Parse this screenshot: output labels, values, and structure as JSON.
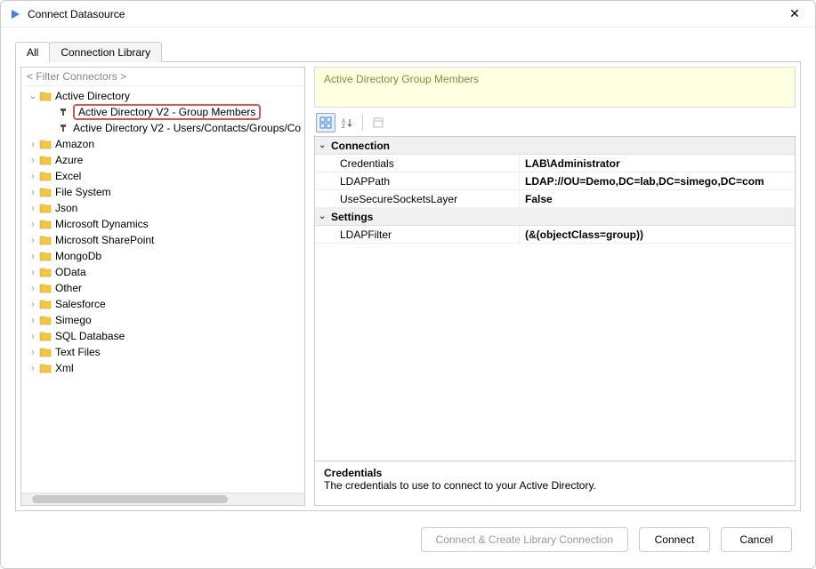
{
  "window": {
    "title": "Connect Datasource"
  },
  "tabs": {
    "all": "All",
    "library": "Connection Library"
  },
  "filter_placeholder": "< Filter Connectors >",
  "tree": {
    "root": "Active Directory",
    "child_selected": "Active Directory V2 - Group Members",
    "child_other": "Active Directory V2 - Users/Contacts/Groups/Co",
    "folders": [
      "Amazon",
      "Azure",
      "Excel",
      "File System",
      "Json",
      "Microsoft Dynamics",
      "Microsoft SharePoint",
      "MongoDb",
      "OData",
      "Other",
      "Salesforce",
      "Simego",
      "SQL Database",
      "Text Files",
      "Xml"
    ]
  },
  "banner": "Active Directory Group Members",
  "propgrid": {
    "groups": [
      {
        "name": "Connection",
        "rows": [
          {
            "k": "Credentials",
            "v": "LAB\\Administrator"
          },
          {
            "k": "LDAPPath",
            "v": "LDAP://OU=Demo,DC=lab,DC=simego,DC=com"
          },
          {
            "k": "UseSecureSocketsLayer",
            "v": "False"
          }
        ]
      },
      {
        "name": "Settings",
        "rows": [
          {
            "k": "LDAPFilter",
            "v": "(&(objectClass=group))"
          }
        ]
      }
    ],
    "desc_title": "Credentials",
    "desc_text": "The credentials to use to connect to your Active Directory."
  },
  "buttons": {
    "create_lib": "Connect & Create Library Connection",
    "connect": "Connect",
    "cancel": "Cancel"
  }
}
